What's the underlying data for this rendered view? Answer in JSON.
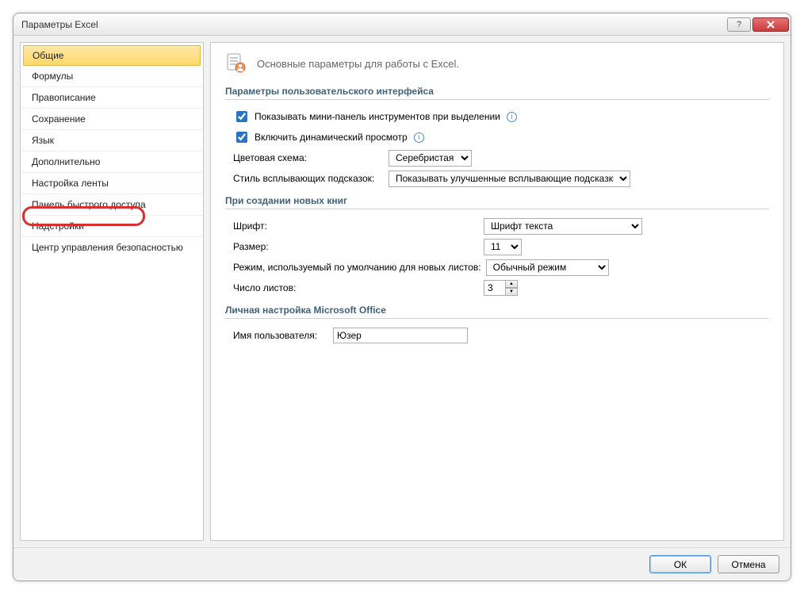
{
  "window": {
    "title": "Параметры Excel"
  },
  "sidebar": {
    "items": [
      {
        "label": "Общие",
        "selected": true
      },
      {
        "label": "Формулы"
      },
      {
        "label": "Правописание"
      },
      {
        "label": "Сохранение"
      },
      {
        "label": "Язык"
      },
      {
        "label": "Дополнительно"
      },
      {
        "label": "Настройка ленты"
      },
      {
        "label": "Панель быстрого доступа"
      },
      {
        "label": "Надстройки"
      },
      {
        "label": "Центр управления безопасностью"
      }
    ]
  },
  "main": {
    "page_heading": "Основные параметры для работы с Excel.",
    "section_ui": {
      "title": "Параметры пользовательского интерфейса",
      "show_mini_toolbar": "Показывать мини-панель инструментов при выделении",
      "live_preview": "Включить динамический просмотр",
      "color_scheme_label": "Цветовая схема:",
      "color_scheme_value": "Серебристая",
      "tooltip_style_label": "Стиль всплывающих подсказок:",
      "tooltip_style_value": "Показывать улучшенные всплывающие подсказки"
    },
    "section_newbook": {
      "title": "При создании новых книг",
      "font_label": "Шрифт:",
      "font_value": "Шрифт текста",
      "size_label": "Размер:",
      "size_value": "11",
      "view_label": "Режим, используемый по умолчанию для новых листов:",
      "view_value": "Обычный режим",
      "sheets_label": "Число листов:",
      "sheets_value": "3"
    },
    "section_personal": {
      "title": "Личная настройка Microsoft Office",
      "username_label": "Имя пользователя:",
      "username_value": "Юзер"
    }
  },
  "footer": {
    "ok": "ОК",
    "cancel": "Отмена"
  }
}
